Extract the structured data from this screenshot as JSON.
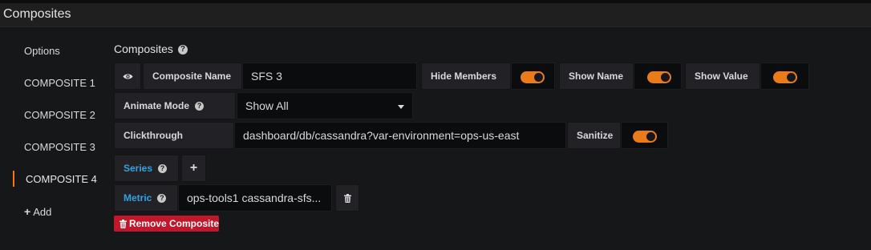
{
  "header": {
    "title": "Composites"
  },
  "sidebar": {
    "items": [
      {
        "label": "Options"
      },
      {
        "label": "COMPOSITE 1"
      },
      {
        "label": "COMPOSITE 2"
      },
      {
        "label": "COMPOSITE 3"
      },
      {
        "label": "COMPOSITE 4",
        "active": true
      }
    ],
    "add_label": "Add"
  },
  "section": {
    "title": "Composites"
  },
  "row1": {
    "composite_name_label": "Composite Name",
    "composite_name_value": "SFS 3",
    "hide_members_label": "Hide Members",
    "hide_members_on": true,
    "show_name_label": "Show Name",
    "show_name_on": true,
    "show_value_label": "Show Value",
    "show_value_on": true
  },
  "row2": {
    "animate_mode_label": "Animate Mode",
    "animate_mode_value": "Show All"
  },
  "row3": {
    "clickthrough_label": "Clickthrough",
    "clickthrough_value": "dashboard/db/cassandra?var-environment=ops-us-east",
    "sanitize_label": "Sanitize",
    "sanitize_on": true
  },
  "series": {
    "label": "Series",
    "add_symbol": "+"
  },
  "metric": {
    "label": "Metric",
    "value": "ops-tools1 cassandra-sfs..."
  },
  "remove_button": {
    "label": "Remove Composite"
  },
  "colors": {
    "accent_orange": "#eb7b18",
    "link_blue": "#33a2e5",
    "danger_red": "#c4162a",
    "background": "#161719"
  }
}
